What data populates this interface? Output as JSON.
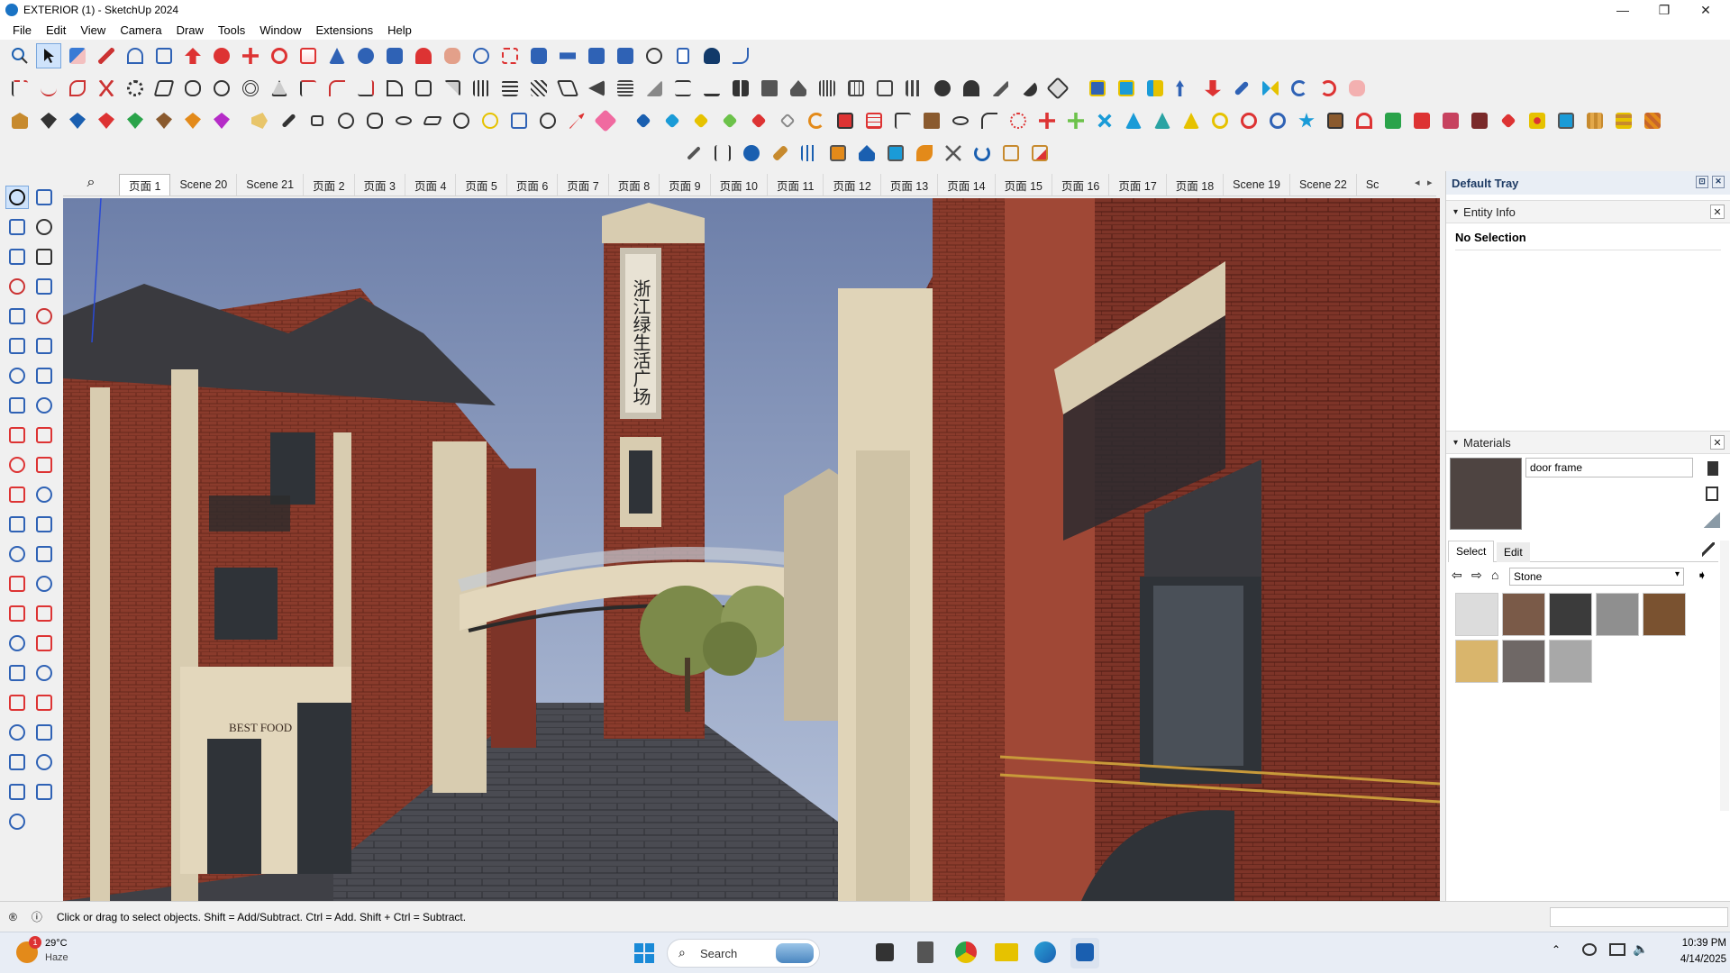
{
  "window": {
    "title": "EXTERIOR  (1) - SketchUp 2024",
    "minimize": "—",
    "maximize": "❐",
    "close": "✕"
  },
  "menu": [
    "File",
    "Edit",
    "View",
    "Camera",
    "Draw",
    "Tools",
    "Window",
    "Extensions",
    "Help"
  ],
  "scene_tabs": [
    "页面 1",
    "Scene 20",
    "Scene 21",
    "页面 2",
    "页面 3",
    "页面 4",
    "页面 5",
    "页面 6",
    "页面 7",
    "页面 8",
    "页面 9",
    "页面 10",
    "页面 11",
    "页面 12",
    "页面 13",
    "页面 14",
    "页面 15",
    "页面 16",
    "页面 17",
    "页面 18",
    "Scene 19",
    "Scene 22",
    "Sc"
  ],
  "viewport": {
    "sign_text": "浙江绿生活广场",
    "shop_sign": "BEST FOOD"
  },
  "tray": {
    "title": "Default Tray",
    "entity_info": {
      "header": "Entity Info",
      "selection": "No Selection"
    },
    "materials": {
      "header": "Materials",
      "name": "door frame",
      "tab_select": "Select",
      "tab_edit": "Edit",
      "library": "Stone",
      "swatches": [
        "#dcdcdc",
        "#7a5a48",
        "#3b3b3b",
        "#8f8f8f",
        "#7a5230",
        "#d9b56c",
        "#6f6866",
        "#a8a8a8"
      ]
    }
  },
  "status": {
    "message": "Click or drag to select objects. Shift = Add/Subtract. Ctrl = Add. Shift + Ctrl = Subtract."
  },
  "taskbar": {
    "weather_temp": "29°C",
    "weather_desc": "Haze",
    "weather_badge": "1",
    "search_placeholder": "Search",
    "time": "10:39 PM",
    "date": "4/14/2025"
  },
  "colors": {
    "accent": "#1a73c4",
    "sky": "#7e8fb7",
    "brick": "#8a3b2c",
    "stone": "#d8ccb0"
  }
}
